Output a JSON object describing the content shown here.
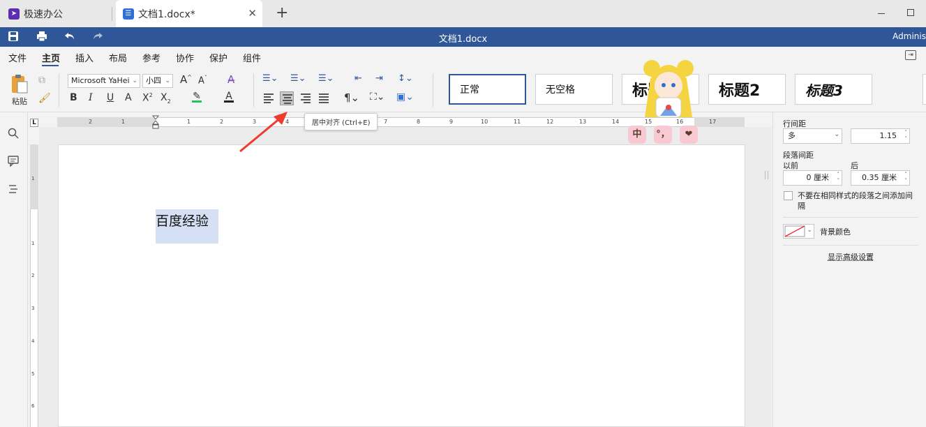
{
  "tabs": {
    "app_label": "极速办公",
    "doc_label": "文档1.docx*",
    "close": "✕",
    "new_tab": "+"
  },
  "titlebar": {
    "doc_title": "文档1.docx",
    "user": "Adminis",
    "accent": "#2f5797"
  },
  "menu": {
    "items": [
      "文件",
      "主页",
      "插入",
      "布局",
      "参考",
      "协作",
      "保护",
      "组件"
    ],
    "active": "主页"
  },
  "ribbon": {
    "paste_label": "粘贴",
    "font_name": "Microsoft YaHei",
    "font_size": "小四",
    "styles": [
      "正常",
      "无空格",
      "标题1",
      "标题2",
      "标题3"
    ]
  },
  "tooltip": {
    "text": "居中对齐 (Ctrl+E)"
  },
  "ruler": {
    "corner": "L",
    "numbers": [
      "2",
      "1",
      "1",
      "2",
      "3",
      "4",
      "5",
      "6",
      "7",
      "8",
      "9",
      "10",
      "11",
      "12",
      "13",
      "14",
      "15",
      "16",
      "17"
    ],
    "vnumbers": [
      "1",
      "1",
      "2",
      "3",
      "4",
      "5",
      "6"
    ]
  },
  "document": {
    "text": "百度经验"
  },
  "right_panel": {
    "line_spacing_label": "行间距",
    "line_spacing_mode": "多",
    "line_spacing_value": "1.15",
    "para_spacing_label": "段落间距",
    "before_label": "以前",
    "after_label": "后",
    "before_value": "0 厘米",
    "after_value": "0.35 厘米",
    "no_space_same_style": "不要在相同样式的段落之间添加间隔",
    "bg_color_label": "背景颜色",
    "advanced_link": "显示高级设置"
  },
  "sticker": {
    "buttons": [
      "中",
      "°，",
      "❤"
    ]
  }
}
